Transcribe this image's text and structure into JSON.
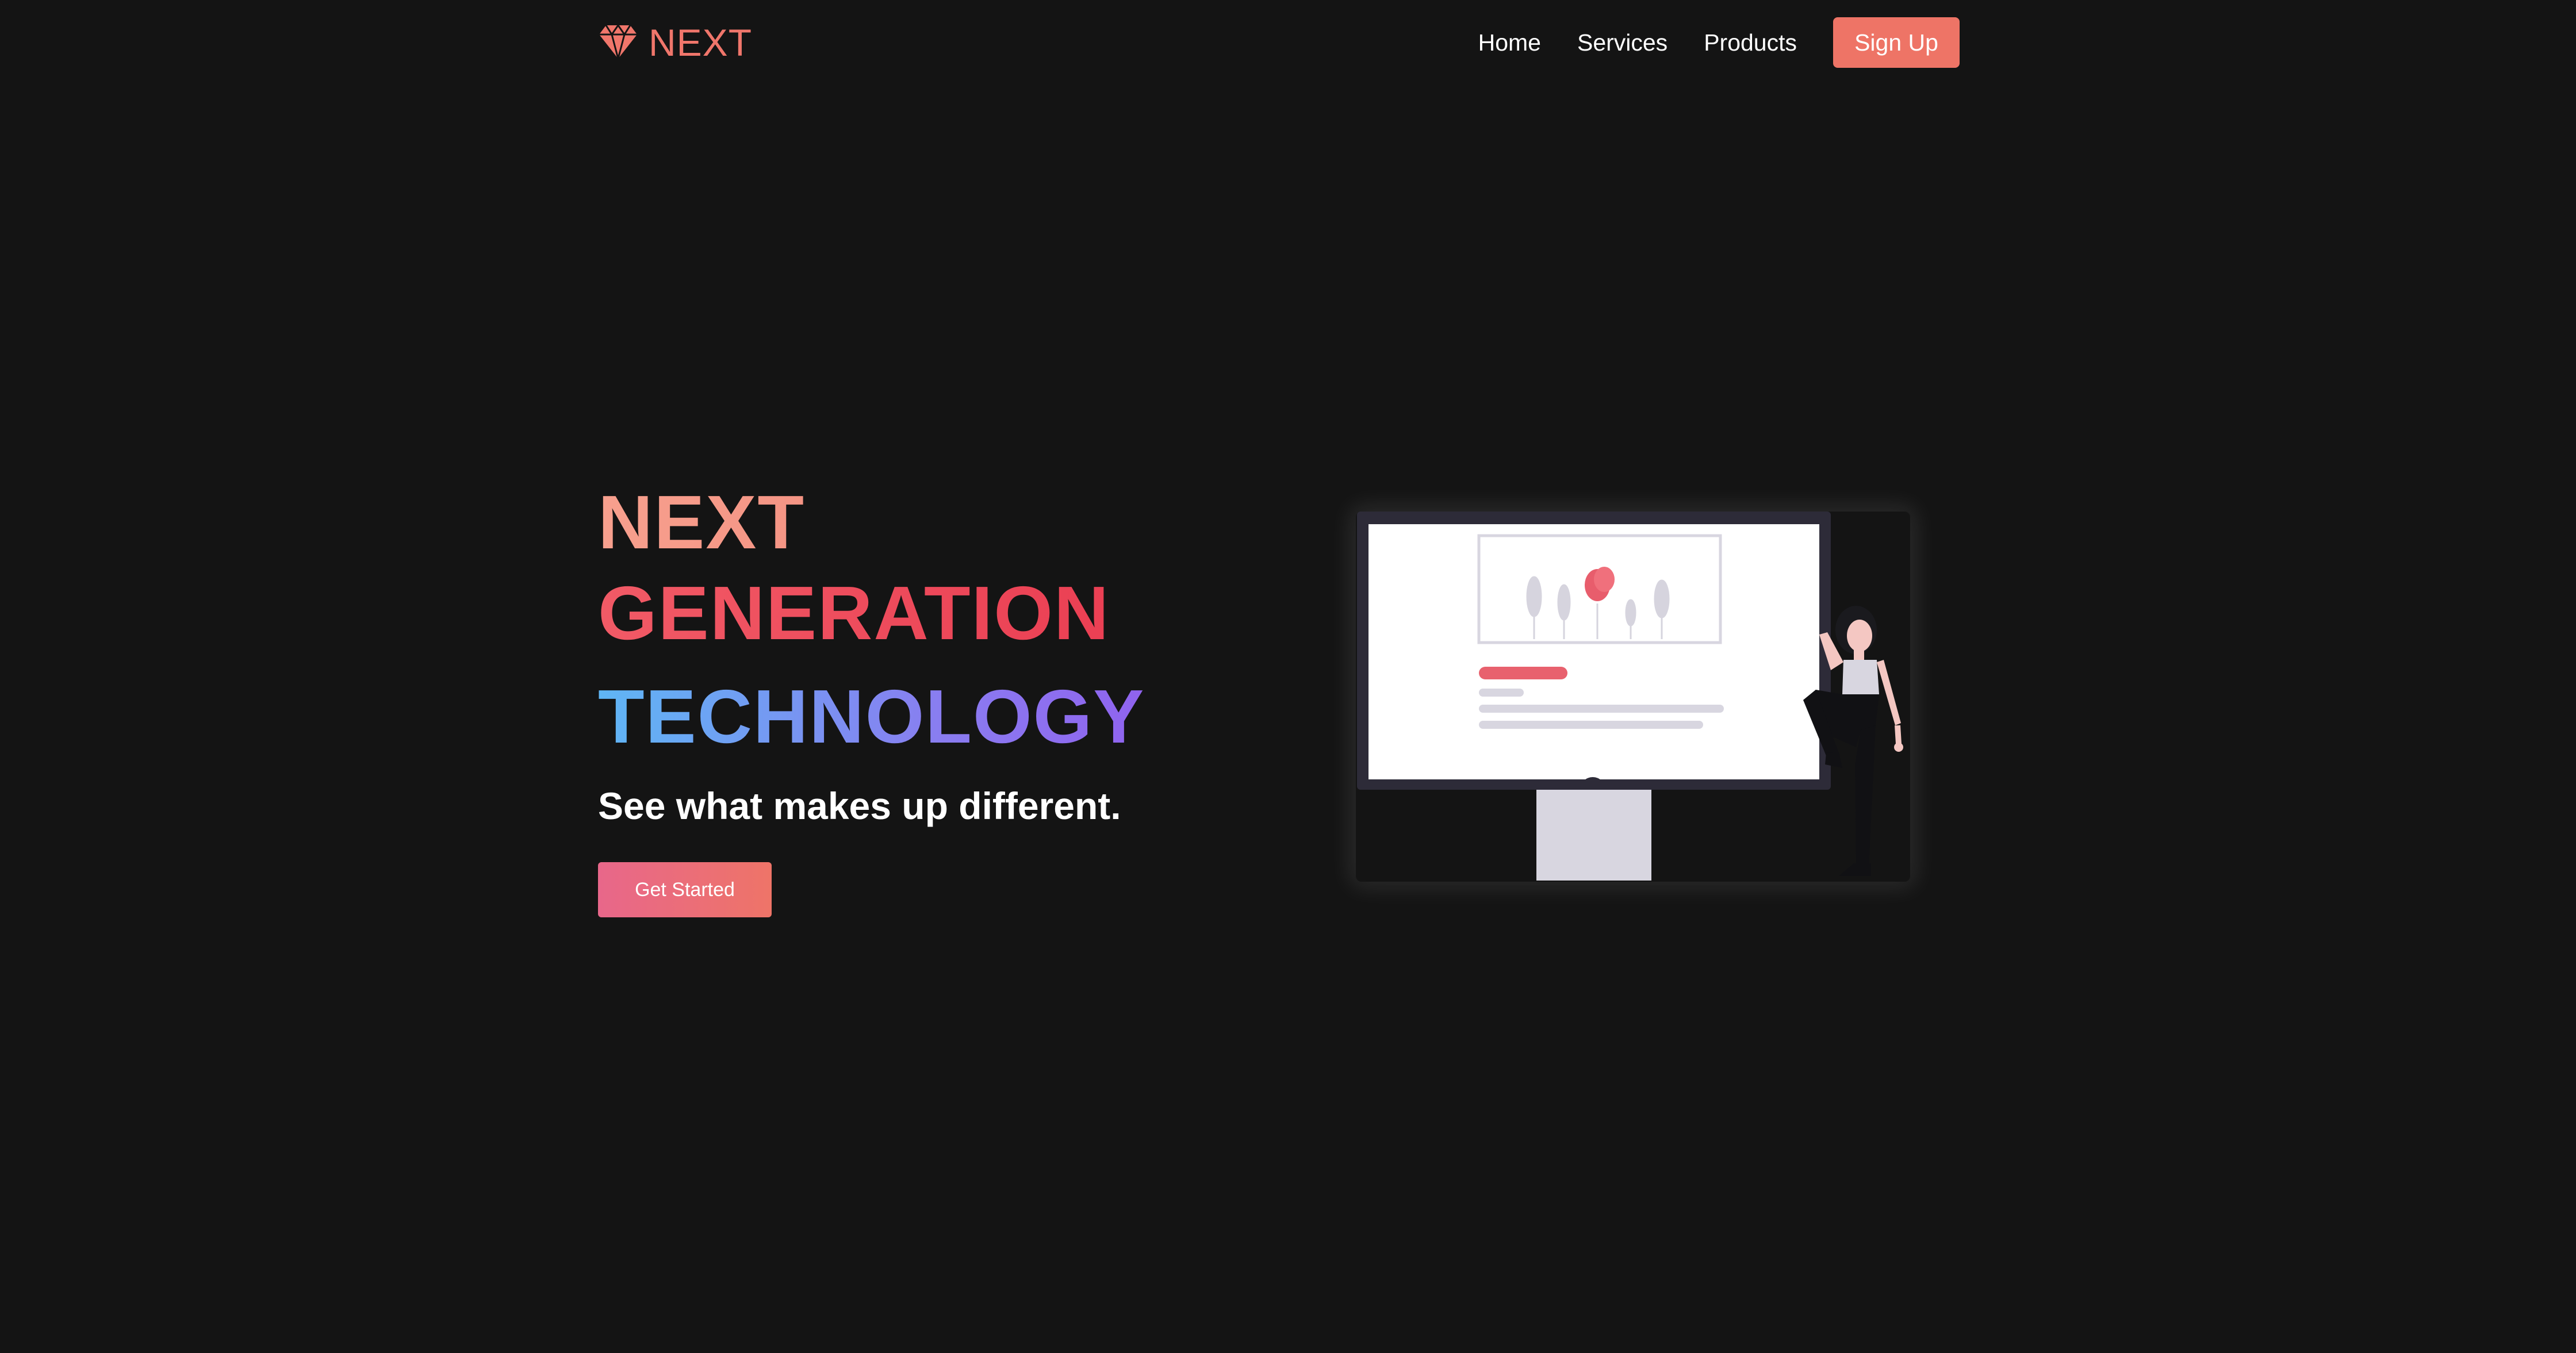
{
  "nav": {
    "logo_text": "NEXT",
    "logo_icon": "diamond-icon",
    "links": [
      "Home",
      "Services",
      "Products"
    ],
    "signup_label": "Sign Up"
  },
  "hero": {
    "title_line1": "NEXT",
    "title_line2": "GENERATION",
    "title_line3": "TECHNOLOGY",
    "subtitle": "See what makes up different.",
    "cta_label": "Get Started"
  },
  "colors": {
    "background": "#141414",
    "accent": "#ee7466",
    "title_pink": "#f15a66",
    "title_blue": "#5fb6f5",
    "title_purple": "#9258ee"
  }
}
